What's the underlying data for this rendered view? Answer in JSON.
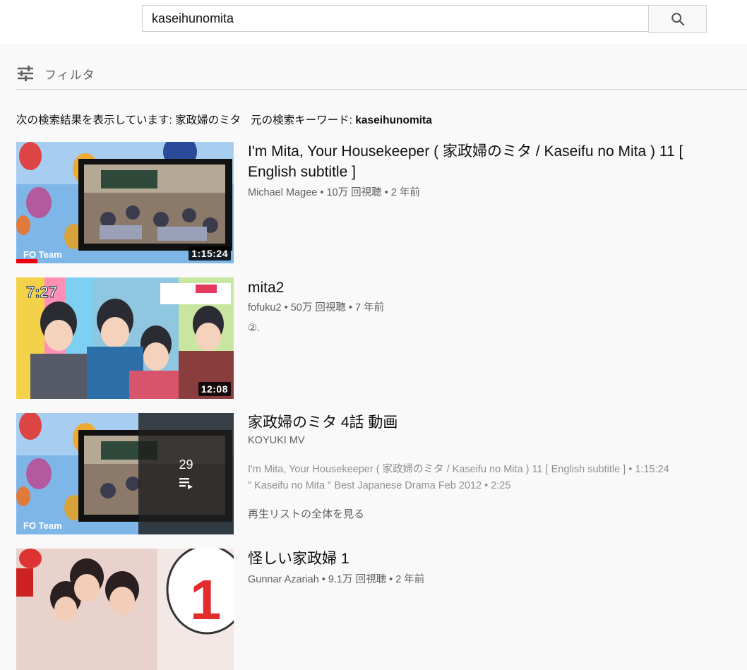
{
  "search": {
    "query": "kaseihunomita",
    "button_icon": "search-icon"
  },
  "filter": {
    "label": "フィルタ",
    "icon": "sliders-icon"
  },
  "showing": {
    "prefix": "次の検索結果を表示しています: ",
    "corrected": "家政婦のミタ",
    "orig_prefix": "元の検索キーワード: ",
    "orig_keyword": "kaseihunomita"
  },
  "results": [
    {
      "title": "I'm Mita, Your Housekeeper ( 家政婦のミタ / Kaseifu no Mita ) 11 [ English subtitle ]",
      "meta": "Michael Magee • 10万 回視聴 • 2 年前",
      "duration": "1:15:24",
      "thumb_overlay_text": "FO Team"
    },
    {
      "title": "mita2",
      "meta": "fofuku2 • 50万 回視聴 • 7 年前",
      "description": "②.",
      "duration": "12:08",
      "thumb_overlay_text": "7:27"
    },
    {
      "title": "家政婦のミタ 4話 動画",
      "channel": "KOYUKI MV",
      "playlist_items": [
        "I'm Mita, Your Housekeeper ( 家政婦のミタ / Kaseifu no Mita ) 11 [ English subtitle ] • 1:15:24",
        "\" Kaseifu no Mita \" Best Japanese Drama Feb 2012 • 2:25"
      ],
      "view_all": "再生リストの全体を見る",
      "playlist_count": "29",
      "thumb_overlay_text": "FO Team"
    },
    {
      "title": "怪しい家政婦 1",
      "meta": "Gunnar Azariah • 9.1万 回視聴 • 2 年前",
      "thumb_overlay_text": "1"
    }
  ]
}
